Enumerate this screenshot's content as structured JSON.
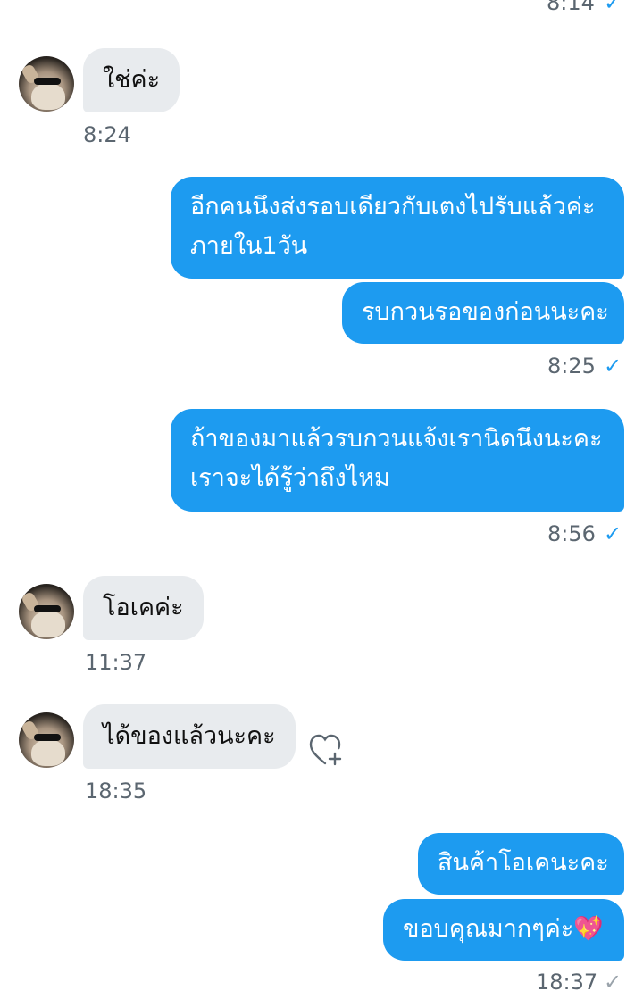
{
  "messages": {
    "top_time": "8:14",
    "m1": {
      "text": "ใช่ค่ะ",
      "time": "8:24"
    },
    "m2": {
      "line1": "อีกคนนึงส่งรอบเดียวกับเตงไปรับแล้วค่ะ",
      "line2": "ภายใน1วัน"
    },
    "m3": {
      "text": "รบกวนรอของก่อนนะคะ",
      "time": "8:25"
    },
    "m4": {
      "line1": "ถ้าของมาแล้วรบกวนแจ้งเรานิดนึงนะคะ",
      "line2": "เราจะได้รู้ว่าถึงไหม",
      "time": "8:56"
    },
    "m5": {
      "text": "โอเคค่ะ",
      "time": "11:37"
    },
    "m6": {
      "text": "ได้ของแล้วนะคะ",
      "time": "18:35"
    },
    "m7": {
      "text": "สินค้าโอเคนะคะ"
    },
    "m8": {
      "text": "ขอบคุณมากๆค่ะ💖",
      "time": "18:37"
    }
  },
  "icons": {
    "read_check": "✓",
    "react": "heart-plus-icon"
  },
  "colors": {
    "outgoing_bubble": "#1d9bf0",
    "incoming_bubble": "#e8ebee",
    "timestamp": "#5b6670",
    "check_read": "#1d9bf0",
    "check_sent": "#9aa3ab"
  }
}
